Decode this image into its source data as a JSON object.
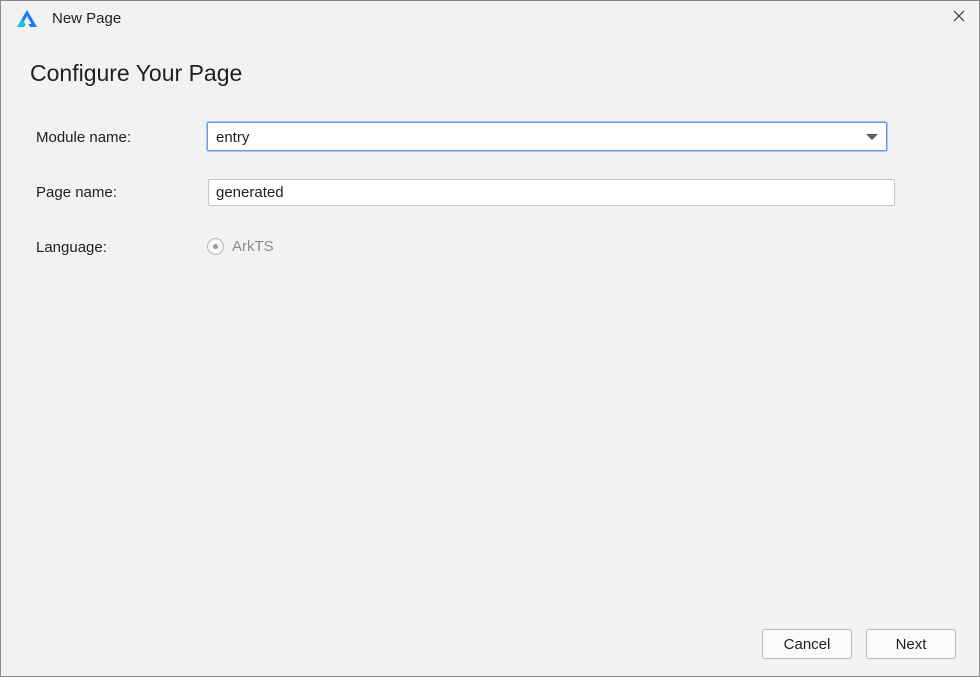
{
  "window": {
    "title": "New Page",
    "app_icon": "deveco-logo-icon",
    "close_icon": "close-icon"
  },
  "heading": "Configure Your Page",
  "form": {
    "module_label": "Module name:",
    "module_value": "entry",
    "page_label": "Page name:",
    "page_value": "generated",
    "language_label": "Language:",
    "language_option": "ArkTS"
  },
  "buttons": {
    "cancel": "Cancel",
    "next": "Next"
  },
  "colors": {
    "focus_border": "#6a9ae0",
    "logo_blue": "#1677ff",
    "logo_teal": "#17c6d4"
  }
}
